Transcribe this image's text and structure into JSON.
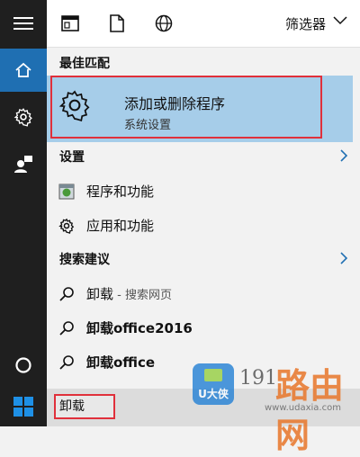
{
  "topbar": {
    "filter_label": "筛选器"
  },
  "sections": {
    "best_match": "最佳匹配",
    "settings": "设置",
    "suggestions": "搜索建议"
  },
  "best_match": {
    "title": "添加或删除程序",
    "subtitle": "系统设置"
  },
  "settings_items": [
    {
      "label": "程序和功能"
    },
    {
      "label": "应用和功能"
    }
  ],
  "suggestion_items": [
    {
      "label": "卸载",
      "hint": " - 搜索网页"
    },
    {
      "label": "卸载office2016"
    },
    {
      "label": "卸载office"
    }
  ],
  "search": {
    "value": "卸载"
  },
  "watermark": {
    "badge": "U大侠",
    "number": "191",
    "road": "路由网",
    "url": "www.udaxia.com"
  },
  "colors": {
    "rail": "#1f1f1f",
    "home_active": "#1f6fb2",
    "selection": "#a6cde9",
    "highlight_box": "#e0303b"
  }
}
